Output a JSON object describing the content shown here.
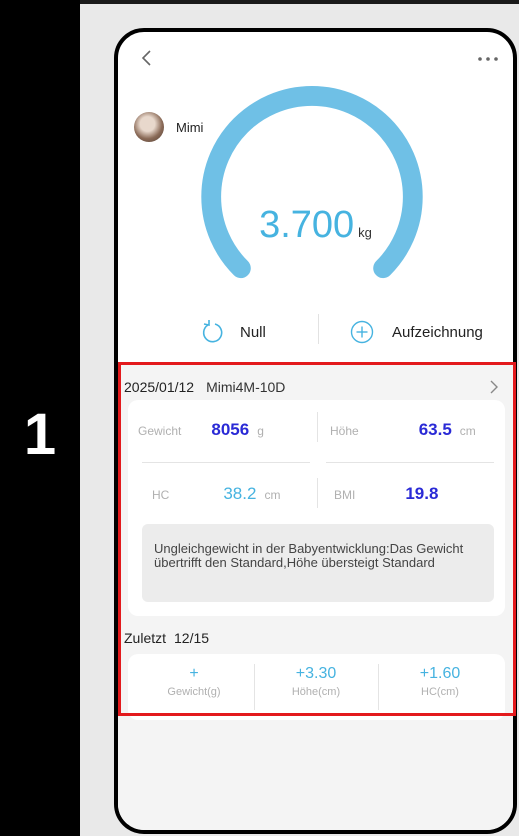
{
  "step_label": "1",
  "profile": {
    "name": "Mimi"
  },
  "scale": {
    "value": "3.700",
    "unit": "kg"
  },
  "actions": {
    "zero_label": "Null",
    "record_label": "Aufzeichnung"
  },
  "record": {
    "date": "2025/01/12",
    "device": "Mimi4M-10D",
    "weight": {
      "label": "Gewicht",
      "value": "8056",
      "unit": "g"
    },
    "height": {
      "label": "Höhe",
      "value": "63.5",
      "unit": "cm"
    },
    "hc": {
      "label": "HC",
      "value": "38.2",
      "unit": "cm"
    },
    "bmi": {
      "label": "BMI",
      "value": "19.8"
    },
    "advice": "Ungleichgewicht in der Babyentwicklung:Das Gewicht übertrifft den Standard,Höhe übersteigt Standard"
  },
  "last": {
    "label": "Zuletzt",
    "date": "12/15",
    "deltas": [
      {
        "value": "+",
        "label": "Gewicht(g)"
      },
      {
        "value": "+3.30",
        "label": "Höhe(cm)"
      },
      {
        "value": "+1.60",
        "label": "HC(cm)"
      }
    ]
  },
  "icons": [
    "back-icon",
    "more-icon",
    "refresh-icon",
    "add-circle-icon",
    "chevron-right-icon"
  ],
  "colors": {
    "accent": "#46b3e0",
    "value_blue": "#2a2ad6",
    "highlight": "#e3191c"
  }
}
